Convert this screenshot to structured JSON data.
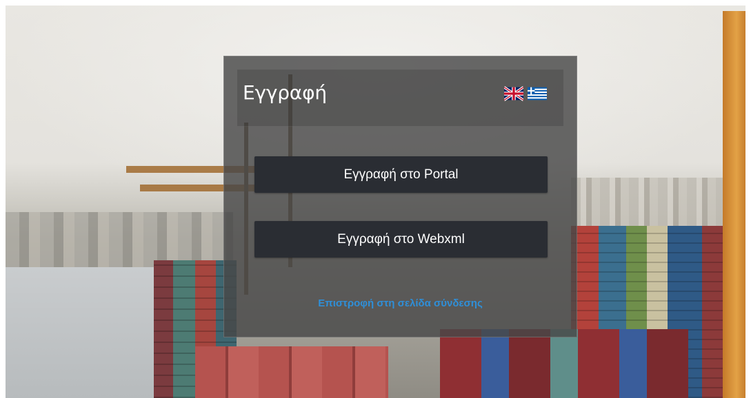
{
  "dialog": {
    "title": "Εγγραφή",
    "language_flags": [
      {
        "icon": "uk-flag-icon",
        "language": "en"
      },
      {
        "icon": "greece-flag-icon",
        "language": "el"
      }
    ],
    "buttons": {
      "register_portal": "Εγγραφή στο Portal",
      "register_webxml": "Εγγραφή στο Webxml"
    },
    "back_link": "Επιστροφή στη σελίδα σύνδεσης"
  },
  "colors": {
    "panel_bg": "#484848",
    "button_bg": "#2a2d33",
    "link": "#2f8fd8"
  }
}
